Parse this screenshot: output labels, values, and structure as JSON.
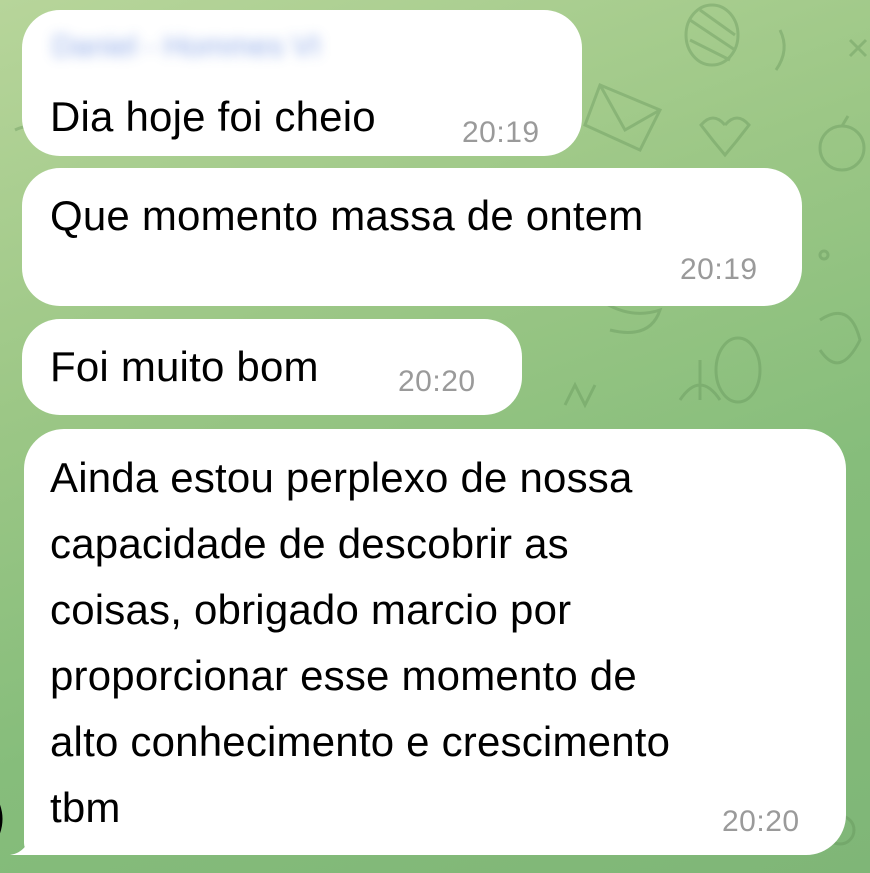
{
  "chat": {
    "sender_name": "Daniel - Hommes VI",
    "messages": [
      {
        "text": "Dia hoje foi cheio",
        "time": "20:19"
      },
      {
        "text": "Que momento massa de ontem",
        "time": "20:19"
      },
      {
        "text": "Foi muito bom",
        "time": "20:20"
      },
      {
        "text": "Ainda estou perplexo de nossa\ncapacidade de descobrir as\ncoisas, obrigado marcio por\nproporcionar esse momento de\nalto conhecimento e crescimento\ntbm",
        "time": "20:20"
      }
    ]
  },
  "colors": {
    "wallpaper": "#9cc786",
    "bubble": "#ffffff",
    "timestamp": "#9a9a9a",
    "sender_name": "#6b8fe0"
  }
}
